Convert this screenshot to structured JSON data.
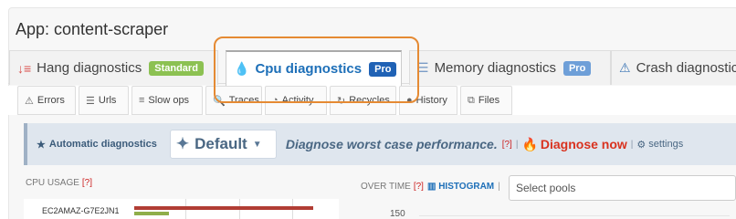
{
  "app": {
    "title": "App: content-scraper"
  },
  "main_tabs": [
    {
      "label": "Hang diagnostics",
      "icon": "sort-down-icon",
      "badge": "Standard",
      "badge_color": "#8cc152",
      "icon_color": "#d9534f"
    },
    {
      "label": "Cpu diagnostics",
      "icon": "flame-icon",
      "badge": "Pro",
      "badge_color": "#2062b5",
      "icon_color": "#1d6fb8",
      "active": true
    },
    {
      "label": "Memory diagnostics",
      "icon": "list-icon",
      "badge": "Pro",
      "badge_color": "#6e9fd8",
      "icon_color": "#7a9cc6"
    },
    {
      "label": "Crash diagnostic",
      "icon": "warning-icon",
      "icon_color": "#3b75b5"
    }
  ],
  "sub_tabs": [
    {
      "label": "Errors",
      "icon": "warning-icon"
    },
    {
      "label": "Urls",
      "icon": "list-icon"
    },
    {
      "label": "Slow ops",
      "icon": "lines-icon"
    },
    {
      "label": "Traces",
      "icon": "search-icon"
    },
    {
      "label": "Activity",
      "icon": "pie-icon"
    },
    {
      "label": "Recycles",
      "icon": "refresh-icon"
    },
    {
      "label": "History",
      "icon": "history-icon"
    },
    {
      "label": "Files",
      "icon": "files-icon"
    }
  ],
  "auto_bar": {
    "label": "Automatic diagnostics",
    "mode": "Default",
    "description": "Diagnose worst case performance.",
    "help": "[?]",
    "diagnose_now": "Diagnose now",
    "separator": "|",
    "settings": "settings"
  },
  "cpu_usage": {
    "label": "CPU USAGE",
    "help": "[?]",
    "host": "EC2AMAZ-G7E2JN1"
  },
  "over_time": {
    "label": "OVER TIME",
    "help": "[?]",
    "histogram": "HISTOGRAM",
    "separator": "|"
  },
  "pools": {
    "placeholder": "Select pools"
  },
  "axis": {
    "tick": "150"
  }
}
